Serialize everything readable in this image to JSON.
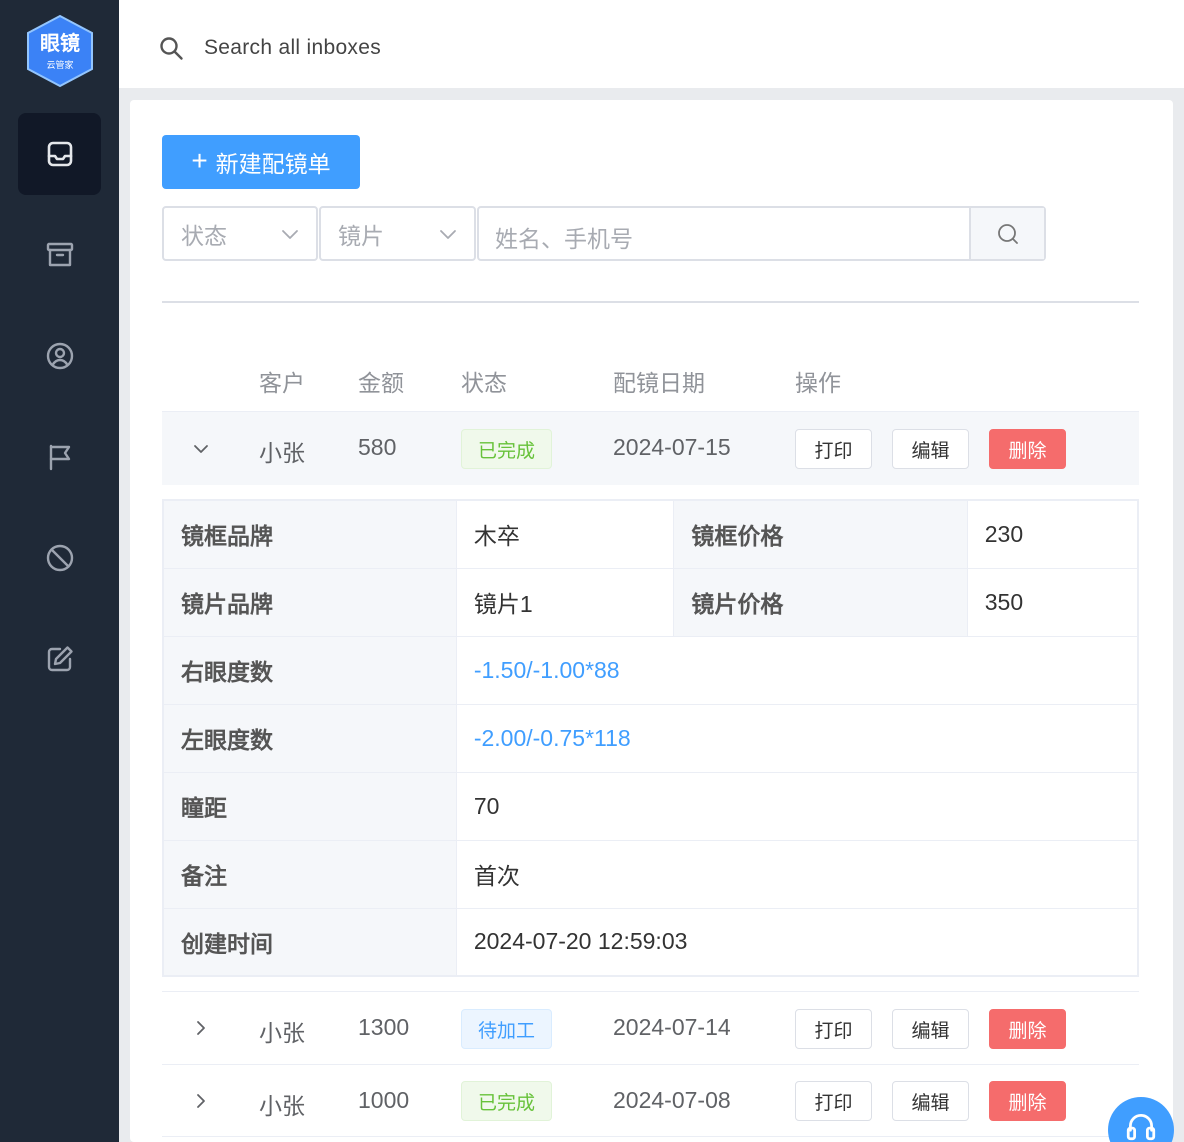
{
  "app": {
    "logo_text": "眼镜",
    "logo_sub": "云管家"
  },
  "topbar": {
    "search_placeholder": "Search all inboxes"
  },
  "toolbar": {
    "new_button_label": "新建配镜单",
    "status_select": "状态",
    "lens_select": "镜片",
    "search_placeholder": "姓名、手机号"
  },
  "table": {
    "headers": [
      "客户",
      "金额",
      "状态",
      "配镜日期",
      "操作"
    ],
    "rows": [
      {
        "customer": "小张",
        "amount": "580",
        "status": "已完成",
        "date": "2024-07-15",
        "expanded": true
      },
      {
        "customer": "小张",
        "amount": "1300",
        "status": "待加工",
        "date": "2024-07-14",
        "expanded": false
      },
      {
        "customer": "小张",
        "amount": "1000",
        "status": "已完成",
        "date": "2024-07-08",
        "expanded": false
      }
    ],
    "actions": {
      "print": "打印",
      "edit": "编辑",
      "delete": "删除"
    }
  },
  "details": {
    "frame_brand_label": "镜框品牌",
    "frame_brand": "木卒",
    "frame_price_label": "镜框价格",
    "frame_price": "230",
    "lens_brand_label": "镜片品牌",
    "lens_brand": "镜片1",
    "lens_price_label": "镜片价格",
    "lens_price": "350",
    "right_eye_label": "右眼度数",
    "right_eye": "-1.50/-1.00*88",
    "left_eye_label": "左眼度数",
    "left_eye": "-2.00/-0.75*118",
    "pd_label": "瞳距",
    "pd": "70",
    "note_label": "备注",
    "note": "首次",
    "created_label": "创建时间",
    "created": "2024-07-20 12:59:03"
  },
  "colors": {
    "sidebar": "#1f2937",
    "primary": "#409eff",
    "success": "#67c23a",
    "danger": "#f56c6c"
  }
}
